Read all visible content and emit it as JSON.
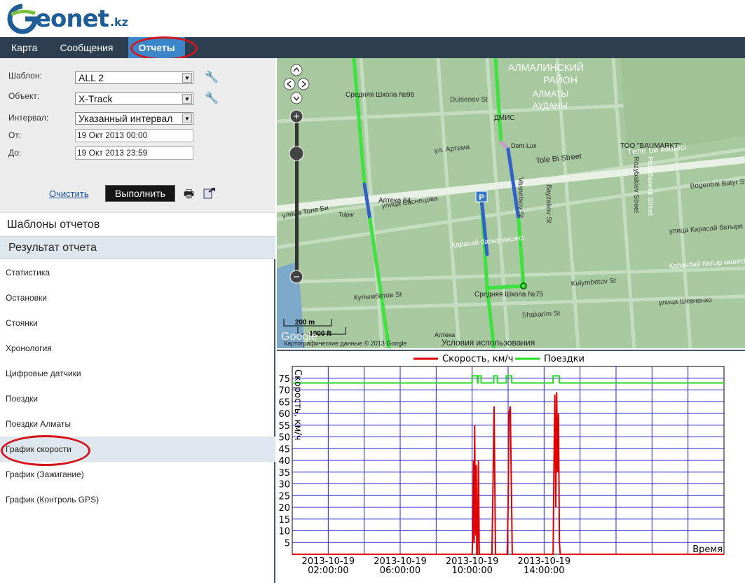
{
  "brand": {
    "name": "eonet",
    "tld": ".kz",
    "logo_colors": {
      "g_green": "#7cc142",
      "g_blue": "#1e5d97"
    }
  },
  "nav": {
    "tabs": [
      {
        "label": "Карта"
      },
      {
        "label": "Сообщения"
      },
      {
        "label": "Отчеты",
        "active": true
      }
    ]
  },
  "form": {
    "template_label": "Шаблон:",
    "template_value": "ALL 2",
    "object_label": "Объект:",
    "object_value": "X-Track",
    "interval_label": "Интервал:",
    "interval_value": "Указанный интервал",
    "from_label": "От:",
    "from_value": "19 Окт 2013 00:00",
    "to_label": "До:",
    "to_value": "19 Окт 2013 23:59",
    "clear_label": "Очистить",
    "run_label": "Выполнить"
  },
  "sections": {
    "templates": "Шаблоны отчетов",
    "result": "Результат отчета"
  },
  "report_items": [
    {
      "label": "Статистика"
    },
    {
      "label": "Остановки"
    },
    {
      "label": "Стоянки"
    },
    {
      "label": "Хронология"
    },
    {
      "label": "Цифровые датчики"
    },
    {
      "label": "Поездки"
    },
    {
      "label": "Поездки Алматы"
    },
    {
      "label": "График скорости",
      "selected": true
    },
    {
      "label": "График (Зажигание)"
    },
    {
      "label": "График (Контроль GPS)"
    }
  ],
  "map": {
    "district": [
      "АЛМАЛИНСКИЙ",
      "РАЙОН",
      "АЛМАТЫ",
      "АУДАНЫ"
    ],
    "streets": [
      "ул. Артема",
      "Tole Bi Street",
      "Төле би көшесі",
      "улица Толе Би",
      "улица Васнецова",
      "Кулымбетов St",
      "Kulymbetov St",
      "Rozybakiev Street",
      "Розыбакиев Street",
      "Bogenbai Batyr Street",
      "Duisenov St",
      "улица Шевченко",
      "Shakarim St",
      "Vasnetsov St",
      "Bayzakov St",
      "Қабанбай батыр көшесі",
      "улица Карасай батыра",
      "Қарасай батыр көшесі"
    ],
    "pois": [
      "Средняя Школа №96",
      "Аптека 84",
      "ДМИС",
      "Dent-Lux",
      "ТОО \"BAUMARKT\"",
      "Средняя Школа №75",
      "Аптека",
      "Tulpar"
    ],
    "scale_m": "200 m",
    "scale_ft": "1000 ft",
    "attribution": "Картографические данные © 2013 Google",
    "terms": "Условия использования",
    "google": "Google",
    "parking": "P"
  },
  "chart_data": {
    "type": "line",
    "legend": [
      {
        "name": "Скорость, км/ч",
        "color": "#e00000"
      },
      {
        "name": "Поездки",
        "color": "#22dd22"
      }
    ],
    "ylabel": "Скорость, км/ч",
    "xlabel": "Время",
    "yticks": [
      5,
      10,
      15,
      20,
      25,
      30,
      35,
      40,
      45,
      50,
      55,
      60,
      65,
      70,
      75
    ],
    "ylim": [
      0,
      80
    ],
    "xlim_hours": [
      0,
      24
    ],
    "xticks": [
      {
        "d": "2013-10-19",
        "t": "02:00:00",
        "h": 2
      },
      {
        "d": "2013-10-19",
        "t": "06:00:00",
        "h": 6
      },
      {
        "d": "2013-10-19",
        "t": "10:00:00",
        "h": 10
      },
      {
        "d": "2013-10-19",
        "t": "14:00:00",
        "h": 14
      }
    ],
    "grid": true,
    "speed_series": [
      [
        0,
        0
      ],
      [
        10.0,
        0
      ],
      [
        10.05,
        10
      ],
      [
        10.08,
        40
      ],
      [
        10.11,
        5
      ],
      [
        10.14,
        55
      ],
      [
        10.17,
        20
      ],
      [
        10.2,
        8
      ],
      [
        10.23,
        38
      ],
      [
        10.26,
        0
      ],
      [
        10.3,
        0
      ],
      [
        10.35,
        40
      ],
      [
        10.4,
        0
      ],
      [
        11.1,
        0
      ],
      [
        11.15,
        25
      ],
      [
        11.22,
        63
      ],
      [
        11.3,
        0
      ],
      [
        11.95,
        0
      ],
      [
        12.0,
        20
      ],
      [
        12.05,
        60
      ],
      [
        12.12,
        63
      ],
      [
        12.18,
        30
      ],
      [
        12.23,
        0
      ],
      [
        14.5,
        0
      ],
      [
        14.55,
        40
      ],
      [
        14.6,
        68
      ],
      [
        14.65,
        20
      ],
      [
        14.7,
        69
      ],
      [
        14.75,
        35
      ],
      [
        14.8,
        60
      ],
      [
        14.85,
        5
      ],
      [
        14.9,
        0
      ],
      [
        24,
        0
      ]
    ],
    "trips_series": [
      [
        0,
        73
      ],
      [
        10.0,
        73
      ],
      [
        10.0,
        76
      ],
      [
        10.3,
        76
      ],
      [
        10.3,
        73
      ],
      [
        10.33,
        73
      ],
      [
        10.33,
        76
      ],
      [
        10.5,
        76
      ],
      [
        10.5,
        73
      ],
      [
        11.2,
        73
      ],
      [
        11.2,
        76
      ],
      [
        11.4,
        76
      ],
      [
        11.4,
        73
      ],
      [
        11.9,
        73
      ],
      [
        11.9,
        76
      ],
      [
        12.2,
        76
      ],
      [
        12.2,
        73
      ],
      [
        14.5,
        73
      ],
      [
        14.5,
        76
      ],
      [
        14.85,
        76
      ],
      [
        14.85,
        73
      ],
      [
        24,
        73
      ]
    ]
  }
}
